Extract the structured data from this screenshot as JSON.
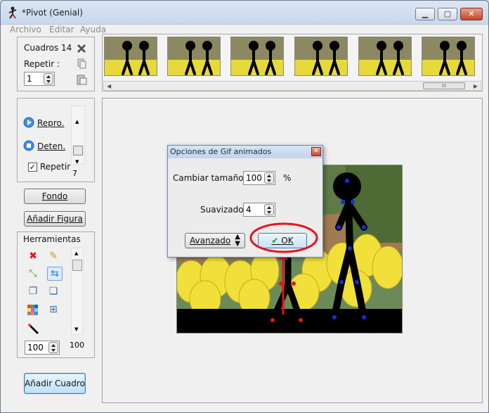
{
  "window": {
    "title": "*Pivot (Genial)",
    "min_glyph": "▁",
    "max_glyph": "▢",
    "close_glyph": "✕"
  },
  "menubar": {
    "items": [
      "Archivo",
      "Editar",
      "Ayuda"
    ]
  },
  "frames_panel": {
    "cuadros_label": "Cuadros 14",
    "repetir_label": "Repetir :",
    "repetir_value": "1"
  },
  "thumbnails": {
    "count": 6,
    "scroll_grip": "III"
  },
  "playback": {
    "play_label": "Repro.",
    "stop_label": "Deten.",
    "repeat_label": "Repetir",
    "repeat_checked": true,
    "speed_value": "7"
  },
  "buttons": {
    "fondo": "Fondo",
    "add_figure": "Añadir Figura",
    "add_frame": "Añadir Cuadro"
  },
  "tools": {
    "heading": "Herramientas",
    "size_value": "100",
    "size_max": "100"
  },
  "gif_dialog": {
    "title": "Opciones de Gif animados",
    "resize_label": "Cambiar tamaño",
    "resize_value": "100",
    "resize_unit": "%",
    "smooth_label": "Suavizado",
    "smooth_value": "4",
    "advanced_label": "Avanzado",
    "ok_label": "OK"
  },
  "colors": {
    "accent_blue": "#3d8ee8",
    "highlight_red": "#e4141c",
    "figure_blue": "#1030e0",
    "figure_red": "#e01818"
  }
}
